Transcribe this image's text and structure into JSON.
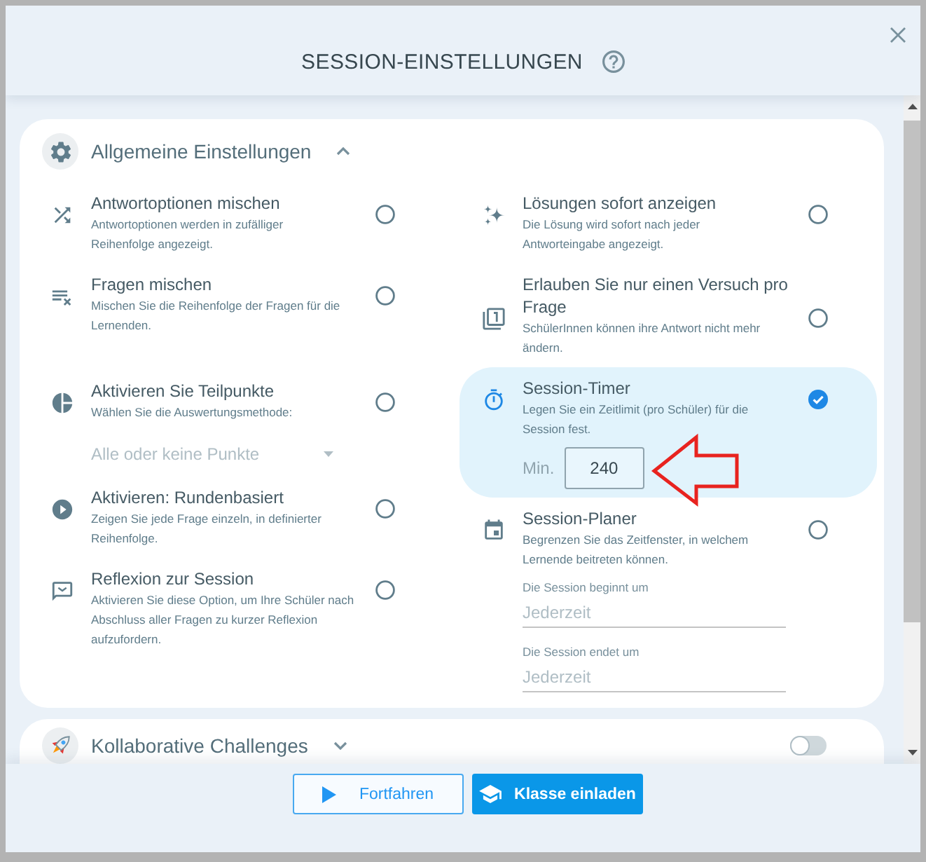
{
  "dialog": {
    "title": "SESSION-EINSTELLUNGEN"
  },
  "sections": [
    {
      "title": "Allgemeine Einstellungen",
      "expanded": true,
      "columns": [
        [
          {
            "title": "Antwortoptionen mischen",
            "description": "Antwortoptionen werden in zufälliger Reihenfolge angezeigt.",
            "checked": false
          },
          {
            "title": "Fragen mischen",
            "description": "Mischen Sie die Reihenfolge der Fragen für die Lernenden.",
            "checked": false
          },
          {
            "title": "Aktivieren Sie Teilpunkte",
            "description": "Wählen Sie die Auswertungsmethode:",
            "checked": false,
            "dropdown": {
              "value": "Alle oder keine Punkte",
              "disabled": true
            }
          },
          {
            "title": "Aktivieren: Rundenbasiert",
            "description": "Zeigen Sie jede Frage einzeln, in definierter Reihenfolge.",
            "checked": false
          },
          {
            "title": "Reflexion zur Session",
            "description": "Aktivieren Sie diese Option, um Ihre Schüler nach Abschluss aller Fragen zu kurzer Reflexion aufzufordern.",
            "checked": false
          }
        ],
        [
          {
            "title": "Lösungen sofort anzeigen",
            "description": "Die Lösung wird sofort nach jeder Antworteingabe angezeigt.",
            "checked": false
          },
          {
            "title": "Erlauben Sie nur einen Versuch pro Frage",
            "description": "SchülerInnen können ihre Antwort nicht mehr ändern.",
            "checked": false
          },
          {
            "title": "Session-Timer",
            "description": "Legen Sie ein Zeitlimit (pro Schüler) für die Session fest.",
            "checked": true,
            "duration": {
              "label": "Min.",
              "value": "240"
            }
          },
          {
            "title": "Session-Planer",
            "description": "Begrenzen Sie das Zeitfenster, in welchem Lernende beitreten können.",
            "checked": false,
            "fields": [
              {
                "label": "Die Session beginnt um",
                "placeholder": "Jederzeit"
              },
              {
                "label": "Die Session endet um",
                "placeholder": "Jederzeit"
              }
            ]
          }
        ]
      ]
    },
    {
      "title": "Kollaborative Challenges",
      "expanded": false,
      "on": false
    }
  ],
  "buttons": [
    {
      "label": "Fortfahren",
      "kind": "secondary"
    },
    {
      "label": "Klasse einladen",
      "kind": "primary"
    }
  ]
}
